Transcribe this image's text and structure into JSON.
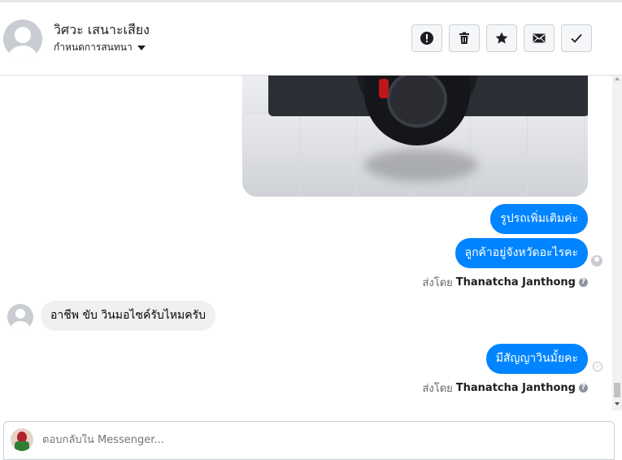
{
  "header": {
    "contact_name": "วิศวะ เสนาะเสียง",
    "subtitle": "กำหนดการสนทนา",
    "actions": [
      {
        "name": "report",
        "icon": "exclamation-circle-icon"
      },
      {
        "name": "delete",
        "icon": "trash-icon"
      },
      {
        "name": "star",
        "icon": "star-icon"
      },
      {
        "name": "mark-unread",
        "icon": "envelope-icon"
      },
      {
        "name": "mark-done",
        "icon": "checkmark-icon"
      }
    ]
  },
  "thread": {
    "image_attachment": {
      "icon": "photo-truck-wheel"
    },
    "outgoing_1": "รูปรถเพิ่มเติมค่ะ",
    "outgoing_2": "ลูกค้าอยู่จังหวัดอะไรคะ",
    "sent_by_1": {
      "prefix": "ส่งโดย",
      "name": "Thanatcha Janthong"
    },
    "incoming_1": "อาชีพ ขับ วินมอไซค์รับไหมครับ",
    "outgoing_3": "มีสัญญาวินมั้ยคะ",
    "sent_by_2": {
      "prefix": "ส่งโดย",
      "name": "Thanatcha Janthong"
    },
    "help_glyph": "?"
  },
  "composer": {
    "placeholder": "ตอบกลับใน Messenger..."
  },
  "colors": {
    "outgoing_bubble": "#0084ff",
    "incoming_bubble": "#f0f0f0"
  }
}
